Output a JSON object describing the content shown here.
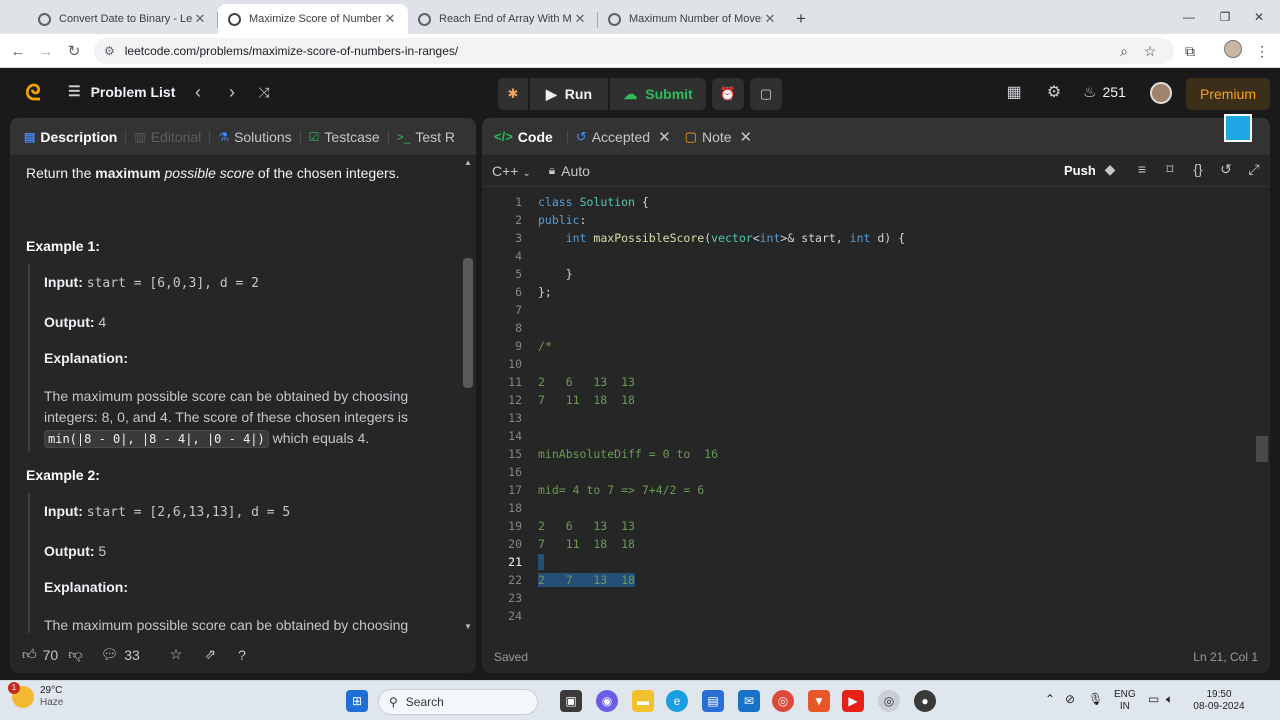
{
  "browser": {
    "tabs": [
      {
        "title": "Convert Date to Binary - LeetCo",
        "active": false
      },
      {
        "title": "Maximize Score of Numbers in",
        "active": true
      },
      {
        "title": "Reach End of Array With Max S",
        "active": false
      },
      {
        "title": "Maximum Number of Moves to",
        "active": false
      }
    ],
    "url": "leetcode.com/problems/maximize-score-of-numbers-in-ranges/"
  },
  "nav": {
    "problem_list": "Problem List",
    "run": "Run",
    "submit": "Submit",
    "streak": "251",
    "premium": "Premium"
  },
  "left_panel": {
    "tabs": [
      {
        "label": "Description",
        "icon": "description-icon",
        "state": "active"
      },
      {
        "label": "Editorial",
        "icon": "editorial-icon",
        "state": "disabled"
      },
      {
        "label": "Solutions",
        "icon": "flask-icon",
        "state": "normal"
      },
      {
        "label": "Testcase",
        "icon": "check-box-icon",
        "state": "normal"
      },
      {
        "label": "Test R",
        "icon": "terminal-icon",
        "state": "normal"
      }
    ],
    "intro_pre": "Return the ",
    "intro_bold": "maximum",
    "intro_italic": "possible score",
    "intro_post": " of the chosen integers.",
    "example1": {
      "title": "Example 1:",
      "input_label": "Input:",
      "input_value": "start = [6,0,3], d = 2",
      "output_label": "Output:",
      "output_value": "4",
      "explanation_label": "Explanation:",
      "explanation_text": "The maximum possible score can be obtained by choosing integers: 8, 0, and 4. The score of these chosen integers is",
      "explanation_code": "min(|8 - 0|, |8 - 4|, |0 - 4|)",
      "explanation_tail": "which equals 4."
    },
    "example2": {
      "title": "Example 2:",
      "input_label": "Input:",
      "input_value": "start = [2,6,13,13], d = 5",
      "output_label": "Output:",
      "output_value": "5",
      "explanation_label": "Explanation:",
      "explanation_text": "The maximum possible score can be obtained by choosing"
    },
    "footer": {
      "likes": "70",
      "comments": "33"
    }
  },
  "right_panel": {
    "tabs": [
      {
        "label": "Code",
        "icon": "code-icon",
        "closable": false
      },
      {
        "label": "Accepted",
        "icon": "history-icon",
        "closable": true
      },
      {
        "label": "Note",
        "icon": "note-icon",
        "closable": true
      }
    ],
    "language": "C++",
    "mode": "Auto",
    "push_label": "Push",
    "status": "Saved",
    "cursor": "Ln 21, Col 1",
    "current_line": 21
  },
  "code_lines": [
    {
      "n": "1"
    },
    {
      "n": "2"
    },
    {
      "n": "3"
    },
    {
      "n": "4"
    },
    {
      "n": "5"
    },
    {
      "n": "6"
    },
    {
      "n": "7"
    },
    {
      "n": "8"
    },
    {
      "n": "9"
    },
    {
      "n": "10"
    },
    {
      "n": "11"
    },
    {
      "n": "12"
    },
    {
      "n": "13"
    },
    {
      "n": "14"
    },
    {
      "n": "15"
    },
    {
      "n": "16"
    },
    {
      "n": "17"
    },
    {
      "n": "18"
    },
    {
      "n": "19"
    },
    {
      "n": "20"
    },
    {
      "n": "21"
    },
    {
      "n": "22"
    },
    {
      "n": "23"
    },
    {
      "n": "24"
    }
  ],
  "code": {
    "l1": "Solution",
    "l3_fn": "maxPossibleScore",
    "l9": "/*",
    "l11": "2   6   13  13",
    "l12": "7   11  18  18",
    "l15": "minAbsoluteDiff = 0 to  16",
    "l17": "mid= 4 to 7 => 7+4/2 = 6",
    "l19": "2   6   13  13",
    "l20": "7   11  18  18",
    "l22": "2   7   13  18"
  },
  "taskbar": {
    "temperature": "29°C",
    "weather": "Haze",
    "search": "Search",
    "lang1": "ENG",
    "lang2": "IN",
    "time": "19:50",
    "date": "08-09-2024",
    "notification_count": "1"
  }
}
